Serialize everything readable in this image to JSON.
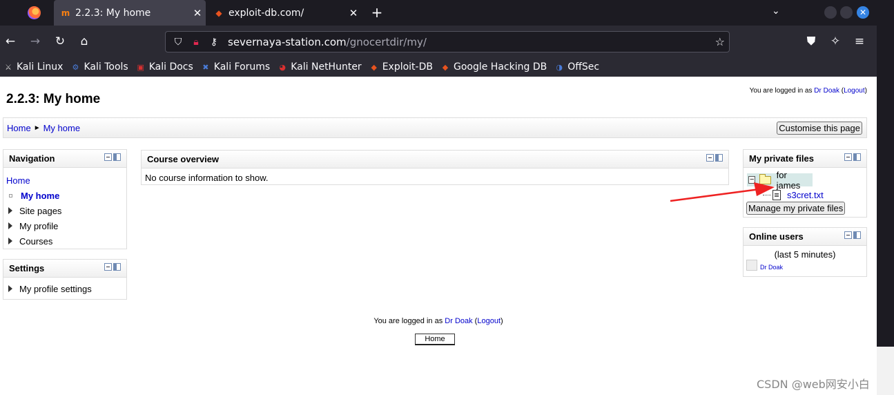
{
  "browser": {
    "tabs": [
      {
        "title": "2.2.3: My home",
        "close": "✕",
        "active": true
      },
      {
        "title": "exploit-db.com/",
        "close": "✕",
        "active": false
      }
    ],
    "new_tab": "+",
    "tab_list": "⌄",
    "url_host": "severnaya-station.com",
    "url_path": "/gnocertdir/my/",
    "bookmarks": [
      {
        "label": "Kali Linux",
        "icon": "kali-dragon-icon"
      },
      {
        "label": "Kali Tools",
        "icon": "kali-tools-icon"
      },
      {
        "label": "Kali Docs",
        "icon": "kali-docs-icon"
      },
      {
        "label": "Kali Forums",
        "icon": "kali-forums-icon"
      },
      {
        "label": "Kali NetHunter",
        "icon": "nethunter-icon"
      },
      {
        "label": "Exploit-DB",
        "icon": "exploit-db-icon"
      },
      {
        "label": "Google Hacking DB",
        "icon": "ghdb-icon"
      },
      {
        "label": "OffSec",
        "icon": "offsec-icon"
      }
    ]
  },
  "page": {
    "title": "2.2.3: My home",
    "login": {
      "prefix": "You are logged in as",
      "user": "Dr Doak",
      "logout": "Logout"
    },
    "breadcrumb": {
      "home": "Home",
      "sep": "►",
      "current": "My home"
    },
    "customise_button": "Customise this page",
    "navigation": {
      "heading": "Navigation",
      "home": "Home",
      "items": [
        {
          "label": "My home",
          "current": true
        },
        {
          "label": "Site pages"
        },
        {
          "label": "My profile"
        },
        {
          "label": "Courses"
        }
      ]
    },
    "settings": {
      "heading": "Settings",
      "items": [
        "My profile settings"
      ]
    },
    "course_overview": {
      "heading": "Course overview",
      "message": "No course information to show."
    },
    "private_files": {
      "heading": "My private files",
      "folder": "for james",
      "file": "s3cret.txt",
      "manage_button": "Manage my private files"
    },
    "online_users": {
      "heading": "Online users",
      "window": "(last 5 minutes)",
      "users": [
        "Dr Doak"
      ]
    },
    "footer": {
      "prefix": "You are logged in as",
      "user": "Dr Doak",
      "logout": "Logout",
      "home_button": "Home"
    }
  },
  "watermark": "CSDN @web网安小白",
  "colors": {
    "link": "#0000cc",
    "arrow": "#ee2222",
    "tab_bg": "#42414d",
    "chrome_bg": "#2b2a33"
  }
}
